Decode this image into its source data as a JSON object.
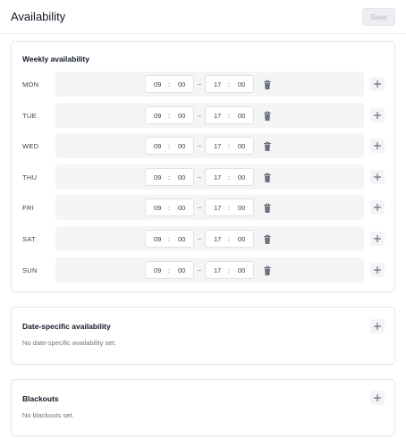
{
  "header": {
    "title": "Availability",
    "save_label": "Save"
  },
  "weekly": {
    "title": "Weekly availability",
    "days": [
      {
        "label": "MON",
        "start_h": "09",
        "start_m": "00",
        "end_h": "17",
        "end_m": "00"
      },
      {
        "label": "TUE",
        "start_h": "09",
        "start_m": "00",
        "end_h": "17",
        "end_m": "00"
      },
      {
        "label": "WED",
        "start_h": "09",
        "start_m": "00",
        "end_h": "17",
        "end_m": "00"
      },
      {
        "label": "THU",
        "start_h": "09",
        "start_m": "00",
        "end_h": "17",
        "end_m": "00"
      },
      {
        "label": "FRI",
        "start_h": "09",
        "start_m": "00",
        "end_h": "17",
        "end_m": "00"
      },
      {
        "label": "SAT",
        "start_h": "09",
        "start_m": "00",
        "end_h": "17",
        "end_m": "00"
      },
      {
        "label": "SUN",
        "start_h": "09",
        "start_m": "00",
        "end_h": "17",
        "end_m": "00"
      }
    ]
  },
  "date_specific": {
    "title": "Date-specific availability",
    "empty_text": "No date-specific availability set."
  },
  "blackouts": {
    "title": "Blackouts",
    "empty_text": "No blackouts set."
  },
  "icons": {
    "delete": "trash-icon",
    "add": "plus-icon"
  },
  "colors": {
    "icon": "#6b7280",
    "row_bg": "#f5f5f6",
    "border": "#e5e7eb"
  }
}
